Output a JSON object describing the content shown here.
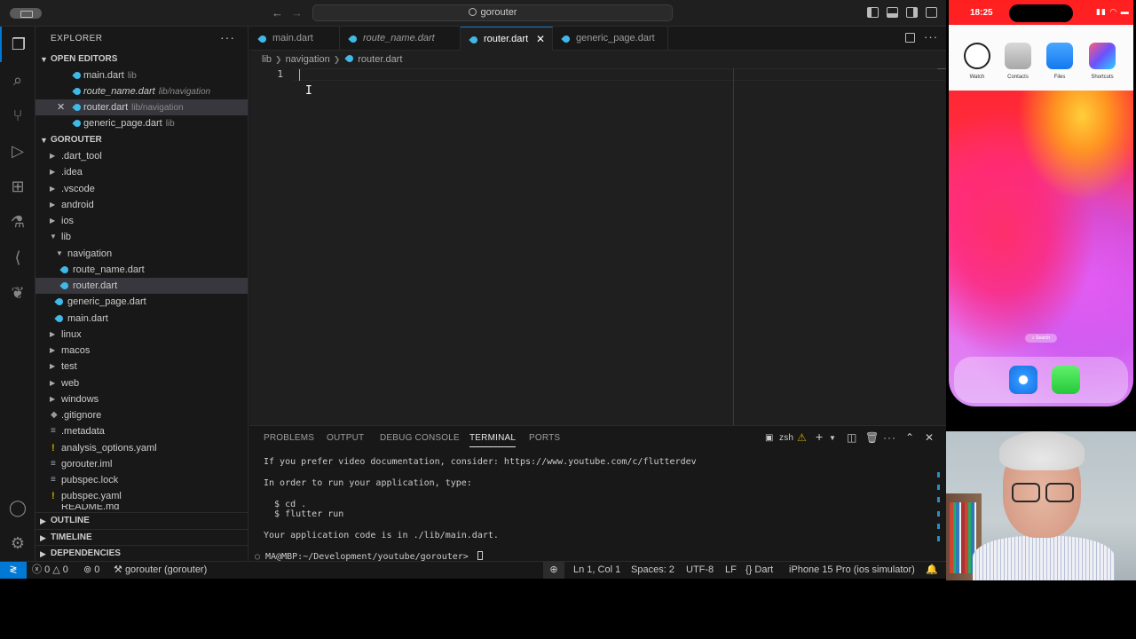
{
  "titlebar": {
    "search_text": "gorouter"
  },
  "explorer": {
    "title": "EXPLORER",
    "open_editors": {
      "title": "OPEN EDITORS",
      "items": [
        {
          "name": "main.dart",
          "path": "lib"
        },
        {
          "name": "route_name.dart",
          "path": "lib/navigation"
        },
        {
          "name": "router.dart",
          "path": "lib/navigation"
        },
        {
          "name": "generic_page.dart",
          "path": "lib"
        }
      ]
    },
    "project": {
      "title": "GOROUTER",
      "items": [
        ".dart_tool",
        ".idea",
        ".vscode",
        "android",
        "ios",
        "lib",
        "navigation",
        "route_name.dart",
        "router.dart",
        "generic_page.dart",
        "main.dart",
        "linux",
        "macos",
        "test",
        "web",
        "windows",
        ".gitignore",
        ".metadata",
        "analysis_options.yaml",
        "gorouter.iml",
        "pubspec.lock",
        "pubspec.yaml",
        "README.md"
      ]
    },
    "outline": "OUTLINE",
    "timeline": "TIMELINE",
    "dependencies": "DEPENDENCIES"
  },
  "tabs": [
    {
      "label": "main.dart"
    },
    {
      "label": "route_name.dart"
    },
    {
      "label": "router.dart"
    },
    {
      "label": "generic_page.dart"
    }
  ],
  "breadcrumbs": [
    "lib",
    "navigation",
    "router.dart"
  ],
  "editor": {
    "line_numbers": [
      "1"
    ]
  },
  "panel": {
    "tabs": [
      "PROBLEMS",
      "OUTPUT",
      "DEBUG CONSOLE",
      "TERMINAL",
      "PORTS"
    ],
    "shell": "zsh",
    "lines": [
      "If you prefer video documentation, consider: https://www.youtube.com/c/flutterdev",
      "In order to run your application, type:",
      "  $ cd .",
      "  $ flutter run",
      "Your application code is in ./lib/main.dart.",
      "MA@MBP:~/Development/youtube/gorouter> "
    ]
  },
  "statusbar": {
    "errors": "0",
    "warnings": "0",
    "ports": "0",
    "branch": "gorouter (gorouter)",
    "position": "Ln 1, Col 1",
    "spaces": "Spaces: 2",
    "encoding": "UTF-8",
    "eol": "LF",
    "language": "Dart",
    "device": "iPhone 15 Pro (ios simulator)"
  },
  "simulator": {
    "time": "18:25",
    "apps": [
      "Watch",
      "Contacts",
      "Files",
      "Shortcuts"
    ],
    "search": "Search"
  }
}
